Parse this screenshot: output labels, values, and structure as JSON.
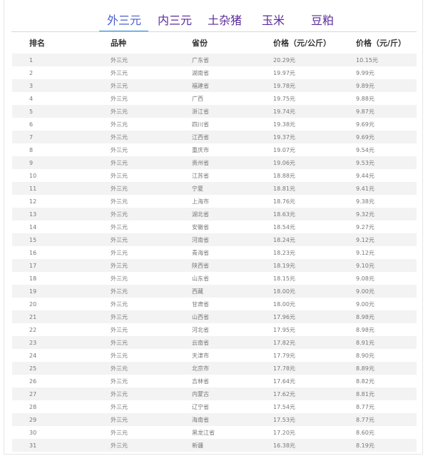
{
  "tabs": [
    {
      "label": "外三元",
      "active": true
    },
    {
      "label": "内三元",
      "active": false
    },
    {
      "label": "土杂猪",
      "active": false
    },
    {
      "label": "玉米",
      "active": false
    },
    {
      "label": "豆粕",
      "active": false
    }
  ],
  "table": {
    "headers": [
      "排名",
      "品种",
      "省份",
      "价格（元/公斤）",
      "价格（元/斤）"
    ],
    "rows": [
      [
        "1",
        "外三元",
        "广东省",
        "20.29元",
        "10.15元"
      ],
      [
        "2",
        "外三元",
        "湖南省",
        "19.97元",
        "9.99元"
      ],
      [
        "3",
        "外三元",
        "福建省",
        "19.78元",
        "9.89元"
      ],
      [
        "4",
        "外三元",
        "广西",
        "19.75元",
        "9.88元"
      ],
      [
        "5",
        "外三元",
        "浙江省",
        "19.74元",
        "9.87元"
      ],
      [
        "6",
        "外三元",
        "四川省",
        "19.38元",
        "9.69元"
      ],
      [
        "7",
        "外三元",
        "江西省",
        "19.37元",
        "9.69元"
      ],
      [
        "8",
        "外三元",
        "重庆市",
        "19.07元",
        "9.54元"
      ],
      [
        "9",
        "外三元",
        "贵州省",
        "19.06元",
        "9.53元"
      ],
      [
        "10",
        "外三元",
        "江苏省",
        "18.88元",
        "9.44元"
      ],
      [
        "11",
        "外三元",
        "宁夏",
        "18.81元",
        "9.41元"
      ],
      [
        "12",
        "外三元",
        "上海市",
        "18.76元",
        "9.38元"
      ],
      [
        "13",
        "外三元",
        "湖北省",
        "18.63元",
        "9.32元"
      ],
      [
        "14",
        "外三元",
        "安徽省",
        "18.54元",
        "9.27元"
      ],
      [
        "15",
        "外三元",
        "河南省",
        "18.24元",
        "9.12元"
      ],
      [
        "16",
        "外三元",
        "青海省",
        "18.23元",
        "9.12元"
      ],
      [
        "17",
        "外三元",
        "陕西省",
        "18.19元",
        "9.10元"
      ],
      [
        "18",
        "外三元",
        "山东省",
        "18.15元",
        "9.08元"
      ],
      [
        "19",
        "外三元",
        "西藏",
        "18.00元",
        "9.00元"
      ],
      [
        "20",
        "外三元",
        "甘肃省",
        "18.00元",
        "9.00元"
      ],
      [
        "21",
        "外三元",
        "山西省",
        "17.96元",
        "8.98元"
      ],
      [
        "22",
        "外三元",
        "河北省",
        "17.95元",
        "8.98元"
      ],
      [
        "23",
        "外三元",
        "云南省",
        "17.82元",
        "8.91元"
      ],
      [
        "24",
        "外三元",
        "天津市",
        "17.79元",
        "8.90元"
      ],
      [
        "25",
        "外三元",
        "北京市",
        "17.78元",
        "8.89元"
      ],
      [
        "26",
        "外三元",
        "吉林省",
        "17.64元",
        "8.82元"
      ],
      [
        "27",
        "外三元",
        "内蒙古",
        "17.62元",
        "8.81元"
      ],
      [
        "28",
        "外三元",
        "辽宁省",
        "17.54元",
        "8.77元"
      ],
      [
        "29",
        "外三元",
        "海南省",
        "17.53元",
        "8.77元"
      ],
      [
        "30",
        "外三元",
        "黑龙江省",
        "17.20元",
        "8.60元"
      ],
      [
        "31",
        "外三元",
        "新疆",
        "16.38元",
        "8.19元"
      ]
    ]
  },
  "colors": {
    "tab_active": "#4a5fd0",
    "tab_inactive": "#5b2b9b",
    "tab_underline": "#2f8bd4",
    "row_stripe": "#f3f3f3"
  }
}
